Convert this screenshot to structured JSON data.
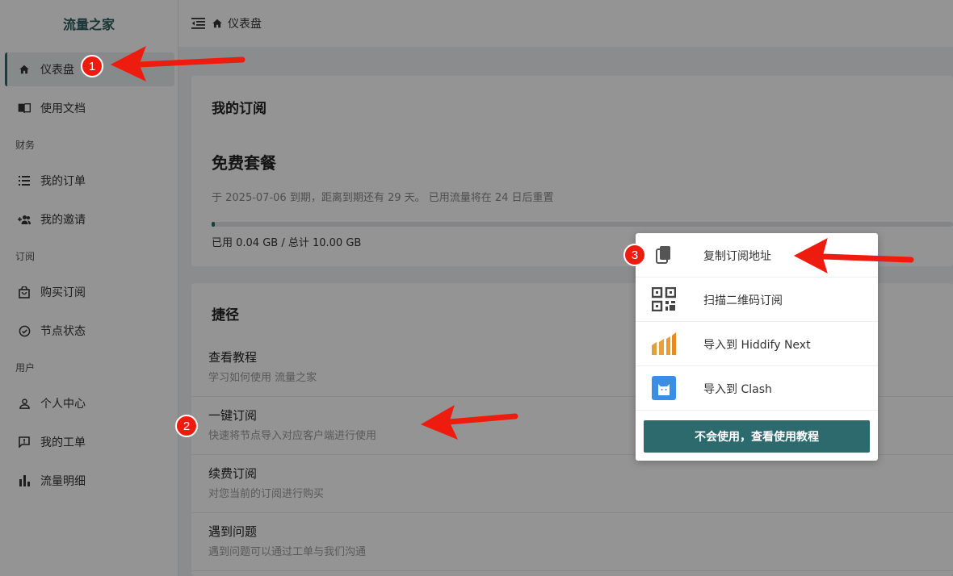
{
  "brand": "流量之家",
  "header": {
    "title": "仪表盘"
  },
  "sidebar": {
    "items": [
      {
        "label": "仪表盘",
        "icon": "home-icon"
      },
      {
        "label": "使用文档",
        "icon": "book-icon"
      },
      {
        "label": "我的订单",
        "icon": "list-icon"
      },
      {
        "label": "我的邀请",
        "icon": "group-add-icon"
      },
      {
        "label": "购买订阅",
        "icon": "shopping-bag-icon"
      },
      {
        "label": "节点状态",
        "icon": "check-circle-icon"
      },
      {
        "label": "个人中心",
        "icon": "person-icon"
      },
      {
        "label": "我的工单",
        "icon": "feedback-icon"
      },
      {
        "label": "流量明细",
        "icon": "bar-chart-icon"
      }
    ],
    "sections": {
      "finance": "财务",
      "subscription": "订阅",
      "user": "用户"
    }
  },
  "subscription": {
    "title": "我的订阅",
    "plan": "免费套餐",
    "expire_text": "于 2025-07-06 到期，距离到期还有 29 天。 已用流量将在 24 日后重置",
    "usage_text": "已用 0.04 GB / 总计 10.00 GB",
    "usage_fraction": 0.004
  },
  "shortcuts": {
    "title": "捷径",
    "items": [
      {
        "title": "查看教程",
        "desc": "学习如何使用 流量之家"
      },
      {
        "title": "一键订阅",
        "desc": "快速将节点导入对应客户端进行使用"
      },
      {
        "title": "续费订阅",
        "desc": "对您当前的订阅进行购买"
      },
      {
        "title": "遇到问题",
        "desc": "遇到问题可以通过工单与我们沟通"
      }
    ]
  },
  "popup": {
    "items": [
      {
        "label": "复制订阅地址",
        "icon": "copy-icon"
      },
      {
        "label": "扫描二维码订阅",
        "icon": "qr-code-icon"
      },
      {
        "label": "导入到 Hiddify Next",
        "icon": "hiddify-icon"
      },
      {
        "label": "导入到 Clash",
        "icon": "clash-icon"
      }
    ],
    "button": "不会使用，查看使用教程"
  },
  "annotations": {
    "badge1": "1",
    "badge2": "2",
    "badge3": "3"
  },
  "colors": {
    "accent": "#2d6a6e",
    "annotation": "#ee1c0e"
  }
}
